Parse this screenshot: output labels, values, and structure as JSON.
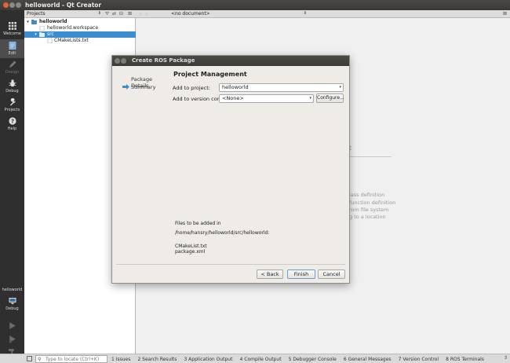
{
  "window": {
    "title": "helloworld - Qt Creator"
  },
  "modes": [
    {
      "label": "Welcome",
      "icon": "grid-icon"
    },
    {
      "label": "Edit",
      "icon": "edit-icon"
    },
    {
      "label": "Design",
      "icon": "pencil-icon"
    },
    {
      "label": "Debug",
      "icon": "bug-icon"
    },
    {
      "label": "Projects",
      "icon": "wrench-icon"
    },
    {
      "label": "Help",
      "icon": "help-icon"
    }
  ],
  "kit": {
    "project": "helloworld",
    "mode": "Debug"
  },
  "projects_panel": {
    "header": "Projects",
    "tree": [
      {
        "label": "helloworld"
      },
      {
        "label": "helloworld.workspace"
      },
      {
        "label": "src"
      },
      {
        "label": "CMakeLists.txt"
      }
    ]
  },
  "editor": {
    "document_select": "<no document>",
    "background_lines": [
      "t",
      "lass definition",
      "function definition",
      "rom file system",
      "g to a location"
    ]
  },
  "status_bar": {
    "locator_placeholder": "Type to locate (Ctrl+K)",
    "panes": [
      "1 Issues",
      "2 Search Results",
      "3 Application Output",
      "4 Compile Output",
      "5 Debugger Console",
      "6 General Messages",
      "7 Version Control",
      "8 ROS Terminals"
    ]
  },
  "dialog": {
    "title": "Create ROS Package",
    "steps": [
      "Package Details",
      "Summary"
    ],
    "page_title": "Project Management",
    "add_to_project_label": "Add to project:",
    "add_to_project_value": "helloworld",
    "version_control_label": "Add to version control:",
    "version_control_value": "<None>",
    "configure_label": "Configure...",
    "files_title": "Files to be added in",
    "files_path": "/home/hansry/helloworld/src/helloworld:",
    "files": [
      "CMakeList.txt",
      "package.xml"
    ],
    "back_label": "< Back",
    "finish_label": "Finish",
    "cancel_label": "Cancel"
  }
}
